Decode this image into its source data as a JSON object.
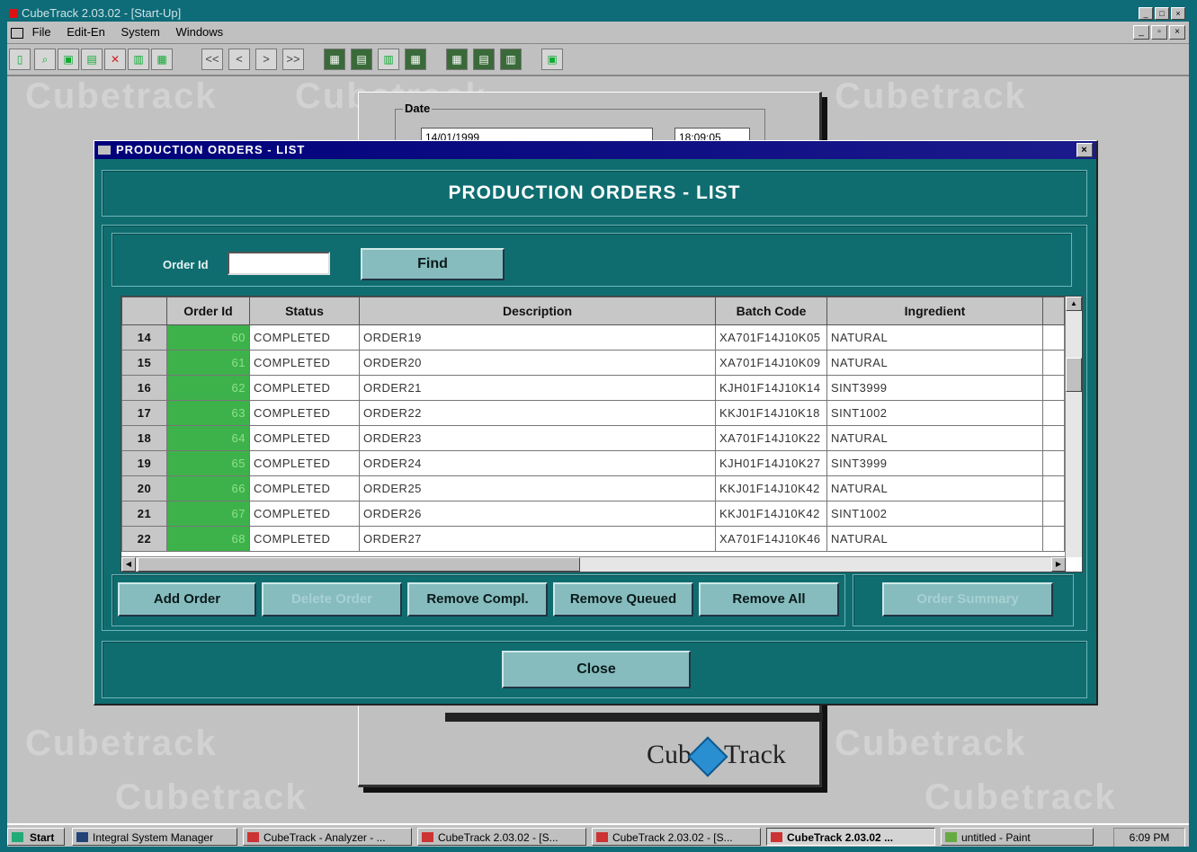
{
  "app": {
    "title": "CubeTrack 2.03.02 - [Start-Up]"
  },
  "menu": {
    "items": [
      "File",
      "Edit-En",
      "System",
      "Windows"
    ]
  },
  "toolbar": {
    "nav": [
      "<<",
      "<",
      ">",
      ">>"
    ]
  },
  "watermark": "Cubetrack",
  "background_window": {
    "date_label": "Date",
    "date_value": "14/01/1999",
    "time_value": "18:09:05",
    "brand": [
      "Cub",
      "Track"
    ]
  },
  "dialog": {
    "window_title": "PRODUCTION ORDERS - LIST",
    "heading": "PRODUCTION ORDERS - LIST",
    "search": {
      "label": "Order Id",
      "value": "",
      "find_label": "Find"
    },
    "table": {
      "columns": [
        "",
        "Order Id",
        "Status",
        "Description",
        "Batch Code",
        "Ingredient"
      ],
      "rows": [
        [
          "14",
          "60",
          "COMPLETED",
          "ORDER19",
          "XA701F14J10K05",
          "NATURAL"
        ],
        [
          "15",
          "61",
          "COMPLETED",
          "ORDER20",
          "XA701F14J10K09",
          "NATURAL"
        ],
        [
          "16",
          "62",
          "COMPLETED",
          "ORDER21",
          "KJH01F14J10K14",
          "SINT3999"
        ],
        [
          "17",
          "63",
          "COMPLETED",
          "ORDER22",
          "KKJ01F14J10K18",
          "SINT1002"
        ],
        [
          "18",
          "64",
          "COMPLETED",
          "ORDER23",
          "XA701F14J10K22",
          "NATURAL"
        ],
        [
          "19",
          "65",
          "COMPLETED",
          "ORDER24",
          "KJH01F14J10K27",
          "SINT3999"
        ],
        [
          "20",
          "66",
          "COMPLETED",
          "ORDER25",
          "KKJ01F14J10K42",
          "NATURAL"
        ],
        [
          "21",
          "67",
          "COMPLETED",
          "ORDER26",
          "KKJ01F14J10K42",
          "SINT1002"
        ],
        [
          "22",
          "68",
          "COMPLETED",
          "ORDER27",
          "XA701F14J10K46",
          "NATURAL"
        ]
      ]
    },
    "buttons": {
      "add_order": "Add Order",
      "delete_order": "Delete Order",
      "remove_completed": "Remove Compl.",
      "remove_queued": "Remove Queued",
      "remove_all": "Remove All",
      "order_summary": "Order Summary",
      "close": "Close"
    },
    "colors": {
      "panel": "#0f6d70",
      "order_id_cell": "#3db24a",
      "title_bar": "#00007a"
    }
  },
  "taskbar": {
    "start": "Start",
    "tasks": [
      "Integral System Manager",
      "CubeTrack - Analyzer - ...",
      "CubeTrack 2.03.02 - [S...",
      "CubeTrack 2.03.02 - [S...",
      "CubeTrack 2.03.02 ...",
      "untitled - Paint"
    ],
    "clock": "6:09 PM"
  }
}
